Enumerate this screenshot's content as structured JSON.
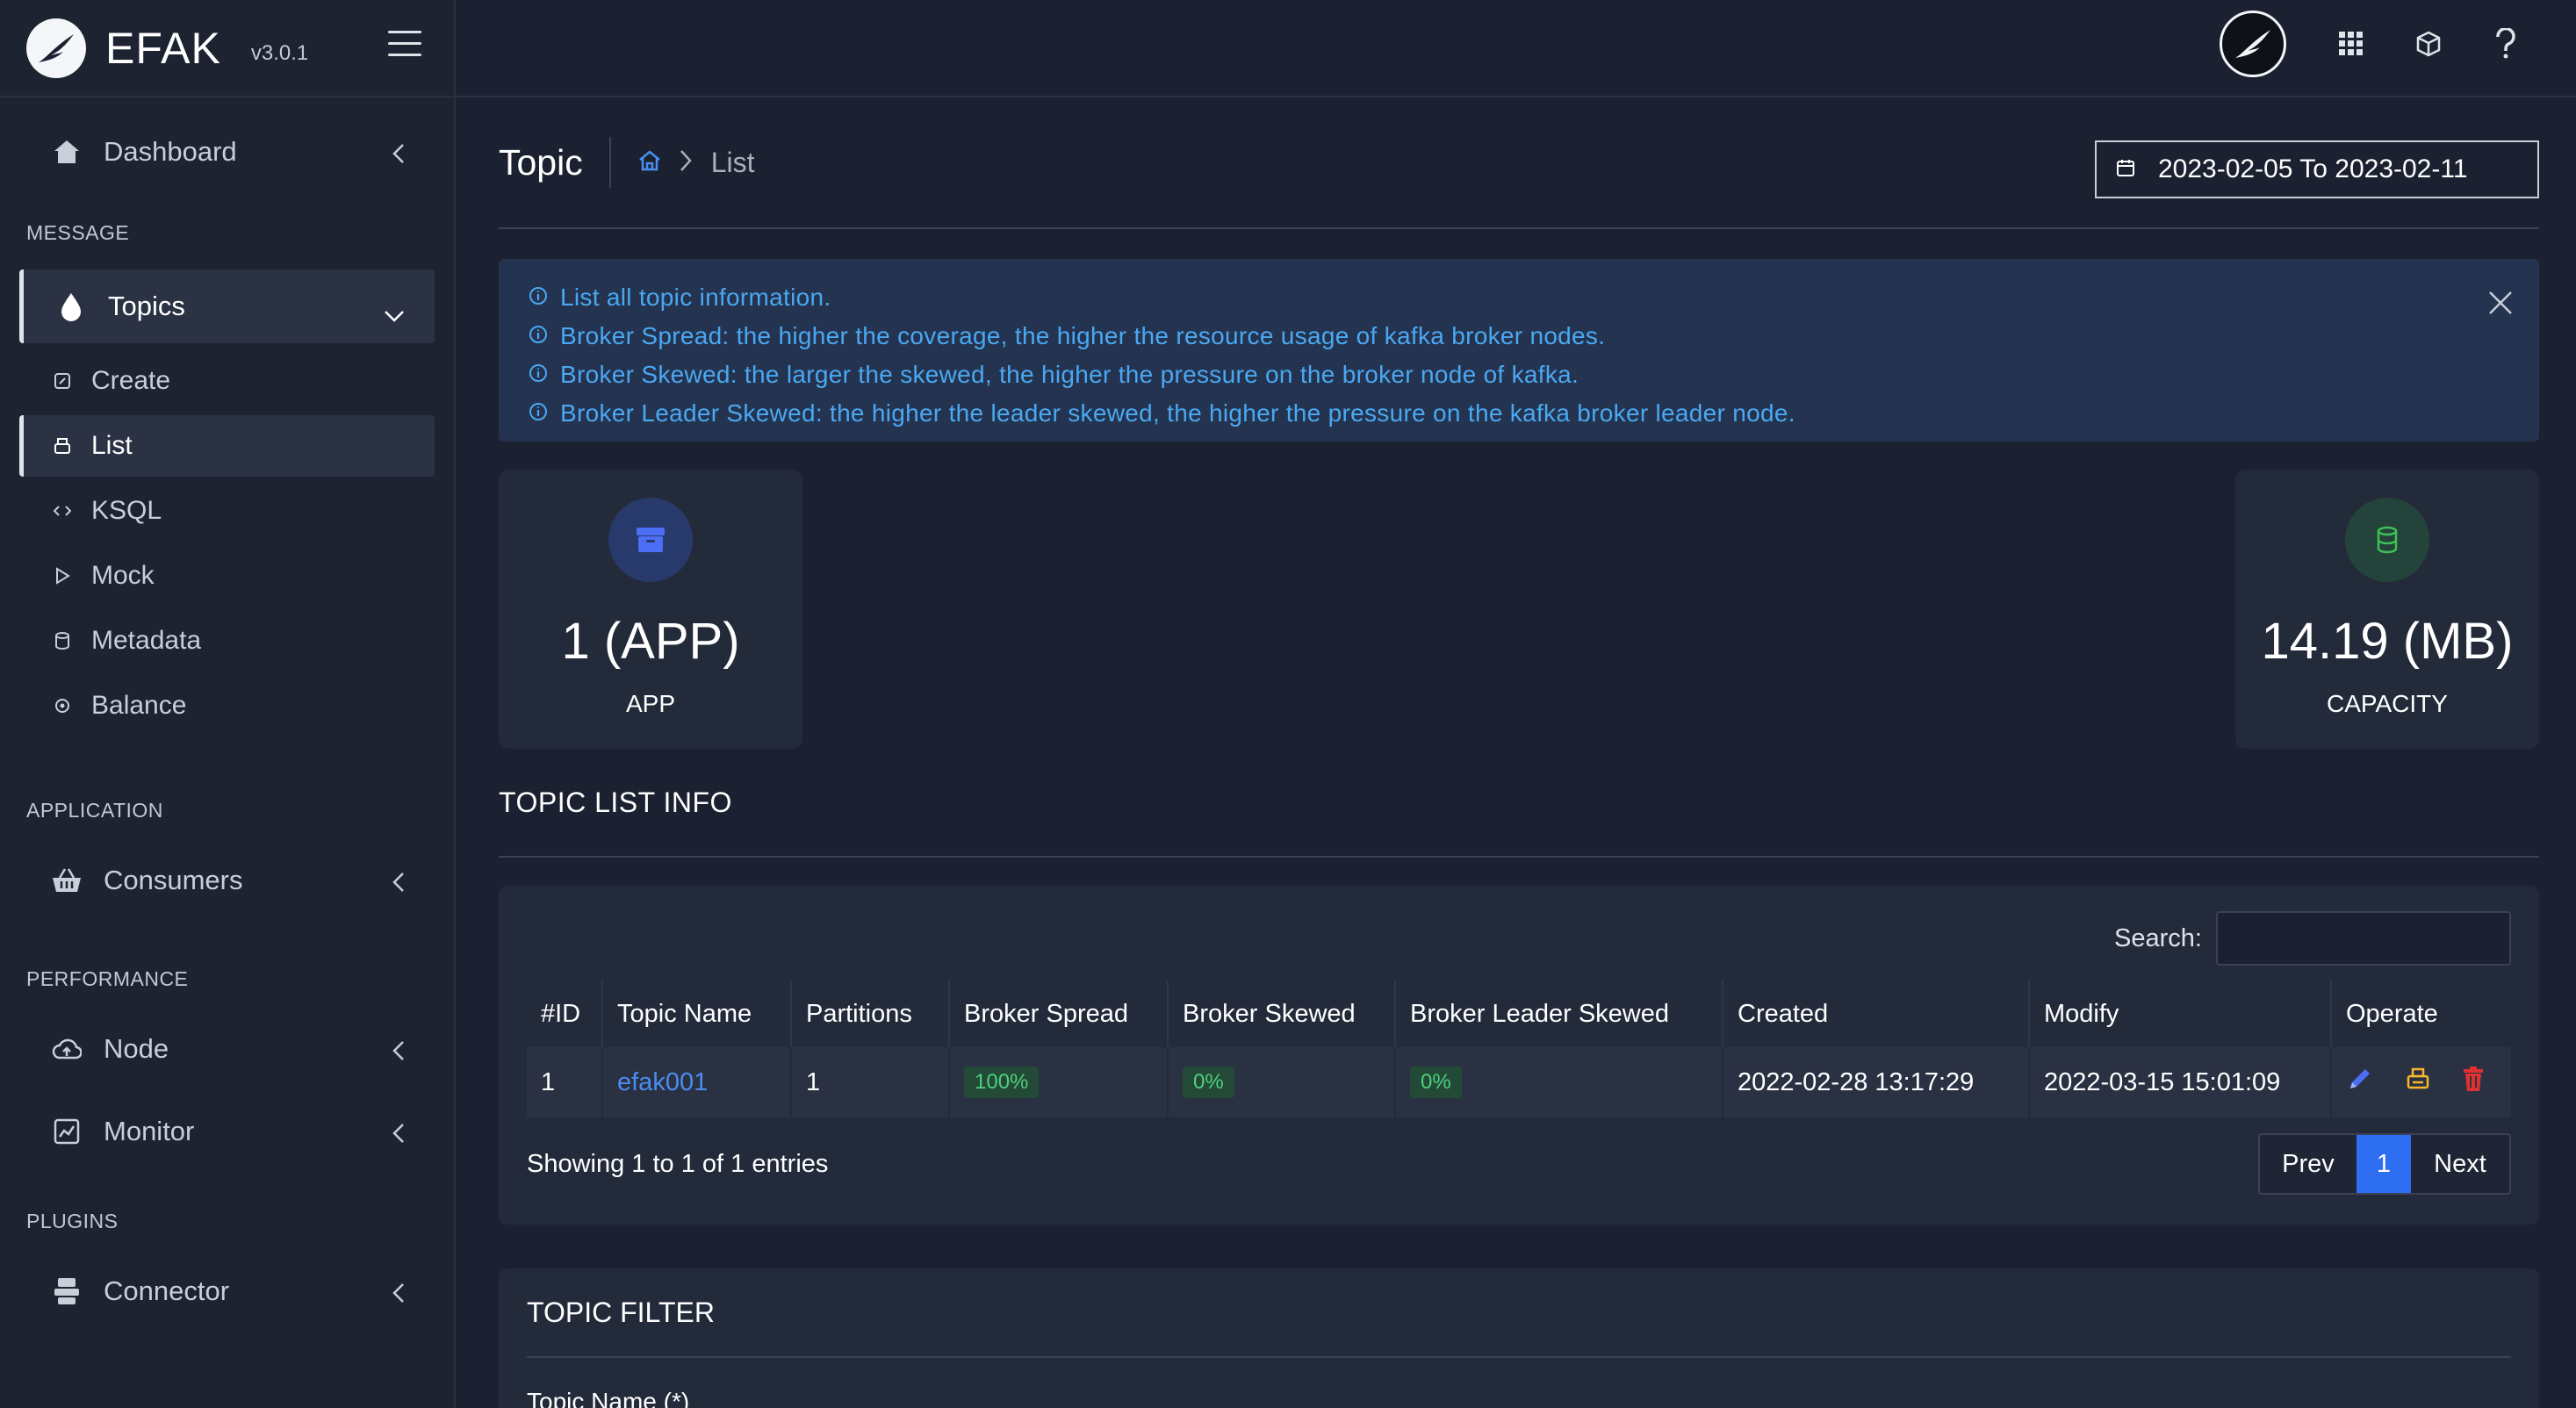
{
  "brand": {
    "name": "EFAK",
    "version": "v3.0.1"
  },
  "sidebar": {
    "dashboard": "Dashboard",
    "sections": {
      "message": "MESSAGE",
      "application": "APPLICATION",
      "performance": "PERFORMANCE",
      "plugins": "PLUGINS"
    },
    "topics": "Topics",
    "topic_subitems": [
      "Create",
      "List",
      "KSQL",
      "Mock",
      "Metadata",
      "Balance"
    ],
    "consumers": "Consumers",
    "node": "Node",
    "monitor": "Monitor",
    "connector": "Connector"
  },
  "header": {
    "page_title": "Topic",
    "breadcrumb_current": "List",
    "date_range": "2023-02-05 To 2023-02-11"
  },
  "alert": {
    "lines": [
      "List all topic information.",
      "Broker Spread: the higher the coverage, the higher the resource usage of kafka broker nodes.",
      "Broker Skewed: the larger the skewed, the higher the pressure on the broker node of kafka.",
      "Broker Leader Skewed: the higher the leader skewed, the higher the pressure on the kafka broker leader node."
    ]
  },
  "stats": {
    "app": {
      "value": "1 (APP)",
      "label": "APP",
      "icon": "archive-icon",
      "color": "#3b5bdb"
    },
    "capacity": {
      "value": "14.19 (MB)",
      "label": "CAPACITY",
      "icon": "database-icon",
      "color": "#40c057"
    }
  },
  "topic_list": {
    "title": "TOPIC LIST INFO",
    "search_label": "Search:",
    "columns": [
      "#ID",
      "Topic Name",
      "Partitions",
      "Broker Spread",
      "Broker Skewed",
      "Broker Leader Skewed",
      "Created",
      "Modify",
      "Operate"
    ],
    "rows": [
      {
        "id": "1",
        "name": "efak001",
        "partitions": "1",
        "spread": "100%",
        "skewed": "0%",
        "leader_skewed": "0%",
        "created": "2022-02-28 13:17:29",
        "modify": "2022-03-15 15:01:09"
      }
    ],
    "info": "Showing 1 to 1 of 1 entries",
    "pager": {
      "prev": "Prev",
      "current": "1",
      "next": "Next"
    }
  },
  "topic_filter": {
    "title": "TOPIC FILTER",
    "field_label": "Topic Name (*)"
  },
  "colors": {
    "accent": "#2e6ef0",
    "link": "#4a8df0",
    "alert_text": "#4aa8f2",
    "success": "#4fcf7f",
    "danger": "#e03131",
    "warning": "#f5b82e"
  }
}
